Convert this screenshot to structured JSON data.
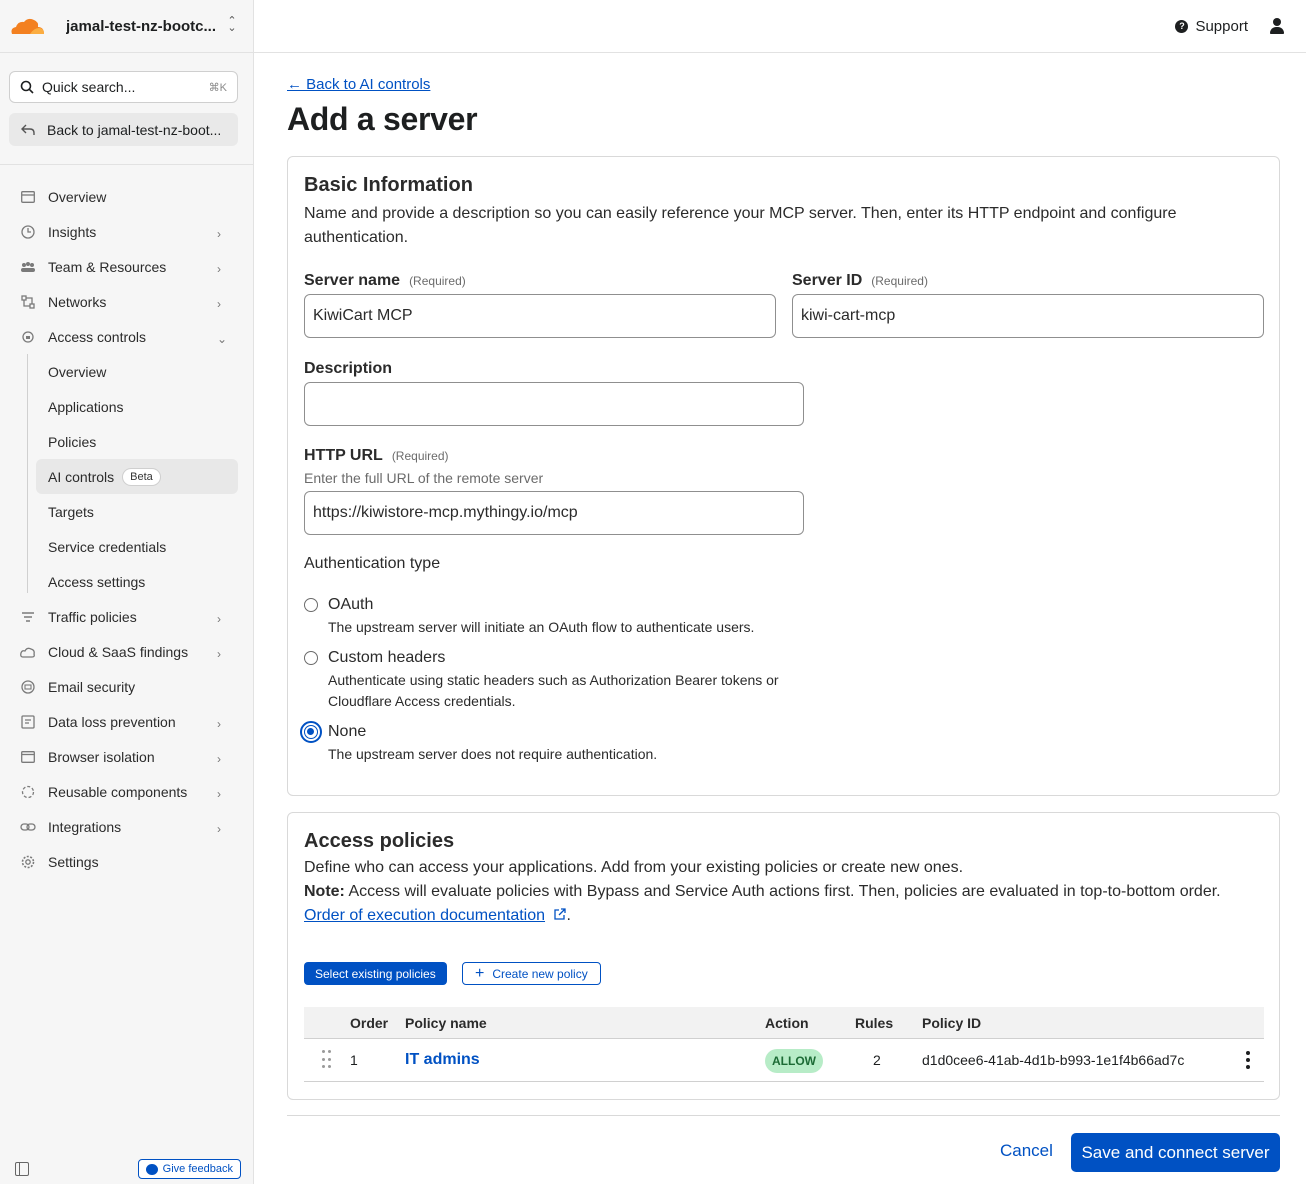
{
  "account": {
    "name": "jamal-test-nz-bootc...",
    "logo": "cloudflare-logo"
  },
  "search": {
    "placeholder": "Quick search...",
    "shortcut": "⌘K"
  },
  "back_to_account": "Back to jamal-test-nz-boot...",
  "nav": {
    "overview": "Overview",
    "insights": "Insights",
    "team": "Team & Resources",
    "networks": "Networks",
    "access_controls": "Access controls",
    "sub": {
      "overview": "Overview",
      "applications": "Applications",
      "policies": "Policies",
      "ai_controls": "AI controls",
      "beta": "Beta",
      "targets": "Targets",
      "service_credentials": "Service credentials",
      "access_settings": "Access settings"
    },
    "traffic_policies": "Traffic policies",
    "cloud_saas": "Cloud & SaaS findings",
    "email_security": "Email security",
    "dlp": "Data loss prevention",
    "browser_isolation": "Browser isolation",
    "reusable": "Reusable components",
    "integrations": "Integrations",
    "settings": "Settings"
  },
  "give_feedback": "Give feedback",
  "topbar": {
    "support": "Support"
  },
  "page": {
    "back_link": "← Back to AI controls",
    "title": "Add a server"
  },
  "basic": {
    "heading": "Basic Information",
    "description": "Name and provide a description so you can easily reference your MCP server. Then, enter its HTTP endpoint and configure authentication.",
    "server_name_label": "Server name",
    "server_name_value": "KiwiCart MCP",
    "server_id_label": "Server ID",
    "server_id_value": "kiwi-cart-mcp",
    "required": "(Required)",
    "description_label": "Description",
    "description_value": "",
    "http_url_label": "HTTP URL",
    "http_url_hint": "Enter the full URL of the remote server",
    "http_url_value": "https://kiwistore-mcp.mythingy.io/mcp",
    "auth_heading": "Authentication type",
    "auth_options": [
      {
        "title": "OAuth",
        "desc": "The upstream server will initiate an OAuth flow to authenticate users.",
        "selected": false
      },
      {
        "title": "Custom headers",
        "desc": "Authenticate using static headers such as Authorization Bearer tokens or Cloudflare Access credentials.",
        "selected": false
      },
      {
        "title": "None",
        "desc": "The upstream server does not require authentication.",
        "selected": true
      }
    ]
  },
  "access": {
    "heading": "Access policies",
    "line1": "Define who can access your applications. Add from your existing policies or create new ones.",
    "note_label": "Note:",
    "note_text": " Access will evaluate policies with Bypass and Service Auth actions first. Then, policies are evaluated in top-to-bottom order.",
    "doc_link": "Order of execution documentation",
    "select_existing": "Select existing policies",
    "create_new": "Create new policy",
    "columns": {
      "order": "Order",
      "policy_name": "Policy name",
      "action": "Action",
      "rules": "Rules",
      "policy_id": "Policy ID"
    },
    "rows": [
      {
        "order": "1",
        "name": "IT admins",
        "action": "ALLOW",
        "rules": "2",
        "policy_id": "d1d0cee6-41ab-4d1b-b993-1e1f4b66ad7c"
      }
    ]
  },
  "footer": {
    "cancel": "Cancel",
    "save": "Save and connect server"
  },
  "colors": {
    "accent": "#0051c3",
    "allow_bg": "#b7ecc7",
    "brand_orange": "#f38020"
  }
}
